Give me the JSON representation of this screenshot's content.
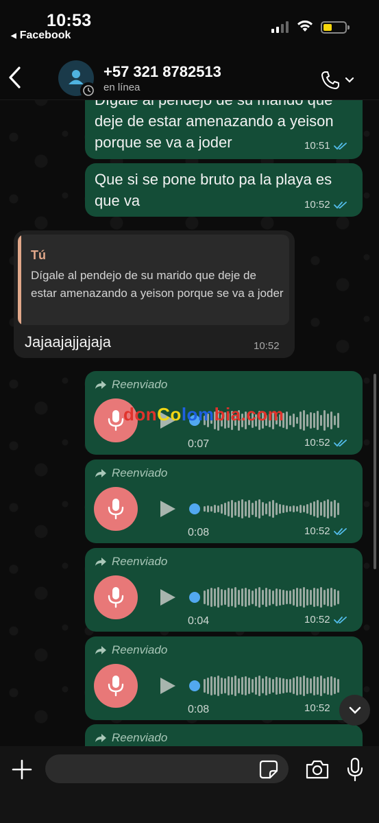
{
  "status_bar": {
    "time": "10:53",
    "back_app": "Facebook"
  },
  "chat_header": {
    "contact": "+57 321 8782513",
    "status": "en línea"
  },
  "messages": [
    {
      "type": "text",
      "direction": "outgoing",
      "text": "Dígale al pendejo de su marido que deje de estar amenazando a yeison porque se va a joder",
      "time": "10:51",
      "read": true
    },
    {
      "type": "text",
      "direction": "outgoing",
      "text": "Que si se pone bruto pa la playa es que va",
      "time": "10:52",
      "read": true
    },
    {
      "type": "reply",
      "direction": "incoming",
      "quote_author": "Tú",
      "quote_text": "Dígale al pendejo de su marido que deje de estar amenazando a yeison porque se va a joder",
      "text": "Jajaajajjajaja",
      "time": "10:52"
    },
    {
      "type": "voice",
      "direction": "outgoing",
      "forwarded_label": "Reenviado",
      "duration": "0:07",
      "time": "10:52",
      "read": true
    },
    {
      "type": "voice",
      "direction": "outgoing",
      "forwarded_label": "Reenviado",
      "duration": "0:08",
      "time": "10:52",
      "read": true
    },
    {
      "type": "voice",
      "direction": "outgoing",
      "forwarded_label": "Reenviado",
      "duration": "0:04",
      "time": "10:52",
      "read": true
    },
    {
      "type": "voice",
      "direction": "outgoing",
      "forwarded_label": "Reenviado",
      "duration": "0:08",
      "time": "10:52",
      "read": false
    },
    {
      "type": "voice",
      "direction": "outgoing",
      "forwarded_label": "Reenviado"
    }
  ],
  "watermark": {
    "part1": "don",
    "part2": "Co",
    "part3": "lom",
    "part4": "bia",
    "part5": ".com"
  },
  "composer": {
    "placeholder": ""
  },
  "colors": {
    "outgoing_bubble": "#144d37",
    "incoming_bubble": "#1f1f1f",
    "read_ticks": "#53bdeb",
    "quote_accent": "#e2a88a",
    "voice_avatar": "#e87878"
  },
  "icons": [
    "back-chevron-icon",
    "contact-avatar-icon",
    "disappearing-timer-icon",
    "phone-icon",
    "forward-arrow-icon",
    "microphone-icon",
    "play-icon",
    "read-ticks-icon",
    "plus-icon",
    "sticker-icon",
    "camera-icon",
    "chevron-down-icon"
  ]
}
